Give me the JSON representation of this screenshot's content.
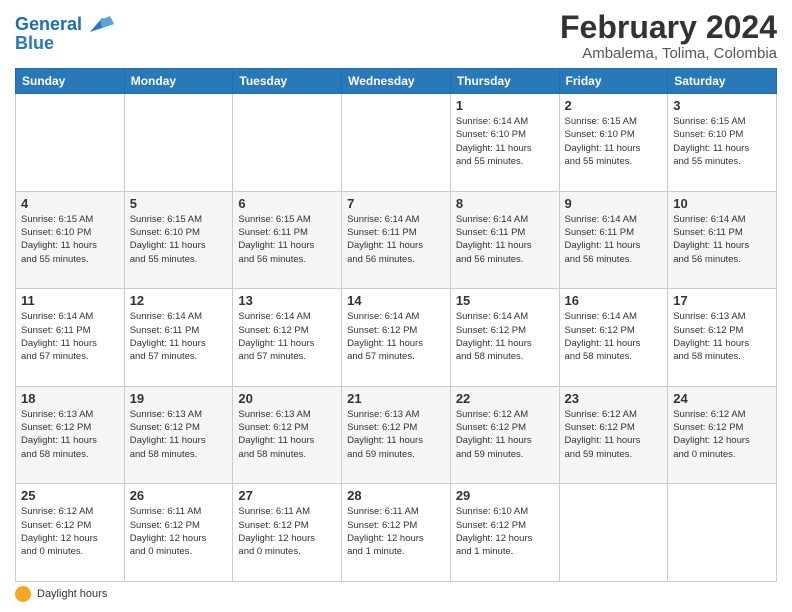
{
  "logo": {
    "line1": "General",
    "line2": "Blue"
  },
  "title": "February 2024",
  "subtitle": "Ambalema, Tolima, Colombia",
  "weekdays": [
    "Sunday",
    "Monday",
    "Tuesday",
    "Wednesday",
    "Thursday",
    "Friday",
    "Saturday"
  ],
  "weeks": [
    [
      {
        "day": "",
        "info": ""
      },
      {
        "day": "",
        "info": ""
      },
      {
        "day": "",
        "info": ""
      },
      {
        "day": "",
        "info": ""
      },
      {
        "day": "1",
        "info": "Sunrise: 6:14 AM\nSunset: 6:10 PM\nDaylight: 11 hours\nand 55 minutes."
      },
      {
        "day": "2",
        "info": "Sunrise: 6:15 AM\nSunset: 6:10 PM\nDaylight: 11 hours\nand 55 minutes."
      },
      {
        "day": "3",
        "info": "Sunrise: 6:15 AM\nSunset: 6:10 PM\nDaylight: 11 hours\nand 55 minutes."
      }
    ],
    [
      {
        "day": "4",
        "info": "Sunrise: 6:15 AM\nSunset: 6:10 PM\nDaylight: 11 hours\nand 55 minutes."
      },
      {
        "day": "5",
        "info": "Sunrise: 6:15 AM\nSunset: 6:10 PM\nDaylight: 11 hours\nand 55 minutes."
      },
      {
        "day": "6",
        "info": "Sunrise: 6:15 AM\nSunset: 6:11 PM\nDaylight: 11 hours\nand 56 minutes."
      },
      {
        "day": "7",
        "info": "Sunrise: 6:14 AM\nSunset: 6:11 PM\nDaylight: 11 hours\nand 56 minutes."
      },
      {
        "day": "8",
        "info": "Sunrise: 6:14 AM\nSunset: 6:11 PM\nDaylight: 11 hours\nand 56 minutes."
      },
      {
        "day": "9",
        "info": "Sunrise: 6:14 AM\nSunset: 6:11 PM\nDaylight: 11 hours\nand 56 minutes."
      },
      {
        "day": "10",
        "info": "Sunrise: 6:14 AM\nSunset: 6:11 PM\nDaylight: 11 hours\nand 56 minutes."
      }
    ],
    [
      {
        "day": "11",
        "info": "Sunrise: 6:14 AM\nSunset: 6:11 PM\nDaylight: 11 hours\nand 57 minutes."
      },
      {
        "day": "12",
        "info": "Sunrise: 6:14 AM\nSunset: 6:11 PM\nDaylight: 11 hours\nand 57 minutes."
      },
      {
        "day": "13",
        "info": "Sunrise: 6:14 AM\nSunset: 6:12 PM\nDaylight: 11 hours\nand 57 minutes."
      },
      {
        "day": "14",
        "info": "Sunrise: 6:14 AM\nSunset: 6:12 PM\nDaylight: 11 hours\nand 57 minutes."
      },
      {
        "day": "15",
        "info": "Sunrise: 6:14 AM\nSunset: 6:12 PM\nDaylight: 11 hours\nand 58 minutes."
      },
      {
        "day": "16",
        "info": "Sunrise: 6:14 AM\nSunset: 6:12 PM\nDaylight: 11 hours\nand 58 minutes."
      },
      {
        "day": "17",
        "info": "Sunrise: 6:13 AM\nSunset: 6:12 PM\nDaylight: 11 hours\nand 58 minutes."
      }
    ],
    [
      {
        "day": "18",
        "info": "Sunrise: 6:13 AM\nSunset: 6:12 PM\nDaylight: 11 hours\nand 58 minutes."
      },
      {
        "day": "19",
        "info": "Sunrise: 6:13 AM\nSunset: 6:12 PM\nDaylight: 11 hours\nand 58 minutes."
      },
      {
        "day": "20",
        "info": "Sunrise: 6:13 AM\nSunset: 6:12 PM\nDaylight: 11 hours\nand 58 minutes."
      },
      {
        "day": "21",
        "info": "Sunrise: 6:13 AM\nSunset: 6:12 PM\nDaylight: 11 hours\nand 59 minutes."
      },
      {
        "day": "22",
        "info": "Sunrise: 6:12 AM\nSunset: 6:12 PM\nDaylight: 11 hours\nand 59 minutes."
      },
      {
        "day": "23",
        "info": "Sunrise: 6:12 AM\nSunset: 6:12 PM\nDaylight: 11 hours\nand 59 minutes."
      },
      {
        "day": "24",
        "info": "Sunrise: 6:12 AM\nSunset: 6:12 PM\nDaylight: 12 hours\nand 0 minutes."
      }
    ],
    [
      {
        "day": "25",
        "info": "Sunrise: 6:12 AM\nSunset: 6:12 PM\nDaylight: 12 hours\nand 0 minutes."
      },
      {
        "day": "26",
        "info": "Sunrise: 6:11 AM\nSunset: 6:12 PM\nDaylight: 12 hours\nand 0 minutes."
      },
      {
        "day": "27",
        "info": "Sunrise: 6:11 AM\nSunset: 6:12 PM\nDaylight: 12 hours\nand 0 minutes."
      },
      {
        "day": "28",
        "info": "Sunrise: 6:11 AM\nSunset: 6:12 PM\nDaylight: 12 hours\nand 1 minute."
      },
      {
        "day": "29",
        "info": "Sunrise: 6:10 AM\nSunset: 6:12 PM\nDaylight: 12 hours\nand 1 minute."
      },
      {
        "day": "",
        "info": ""
      },
      {
        "day": "",
        "info": ""
      }
    ]
  ],
  "footer": {
    "daylight_label": "Daylight hours"
  },
  "colors": {
    "header_bg": "#2979b8",
    "alt_row": "#f5f5f5"
  }
}
